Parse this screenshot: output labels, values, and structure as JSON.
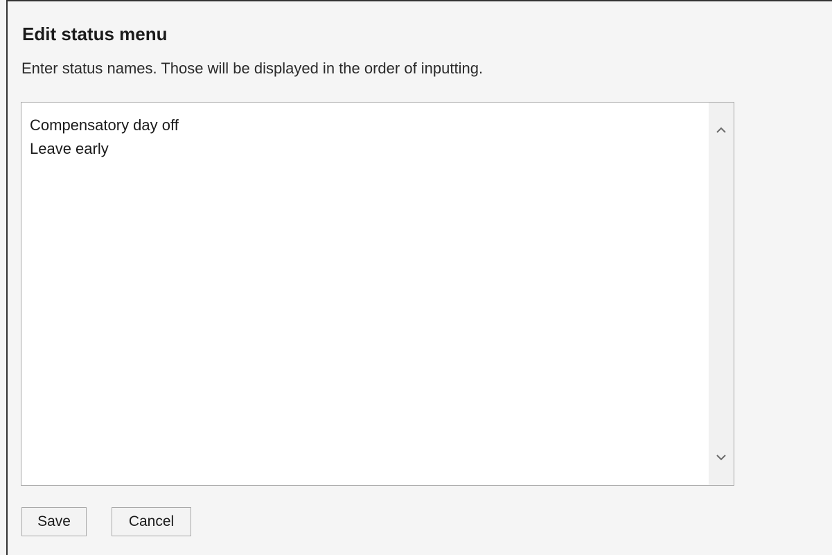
{
  "dialog": {
    "title": "Edit status menu",
    "description": "Enter status names. Those will be displayed in the order of inputting."
  },
  "status_list": {
    "lines": [
      "Compensatory day off",
      "Leave early"
    ]
  },
  "scrollbar": {
    "up_icon": "chevron-up-icon",
    "down_icon": "chevron-down-icon"
  },
  "actions": {
    "save_label": "Save",
    "cancel_label": "Cancel"
  }
}
